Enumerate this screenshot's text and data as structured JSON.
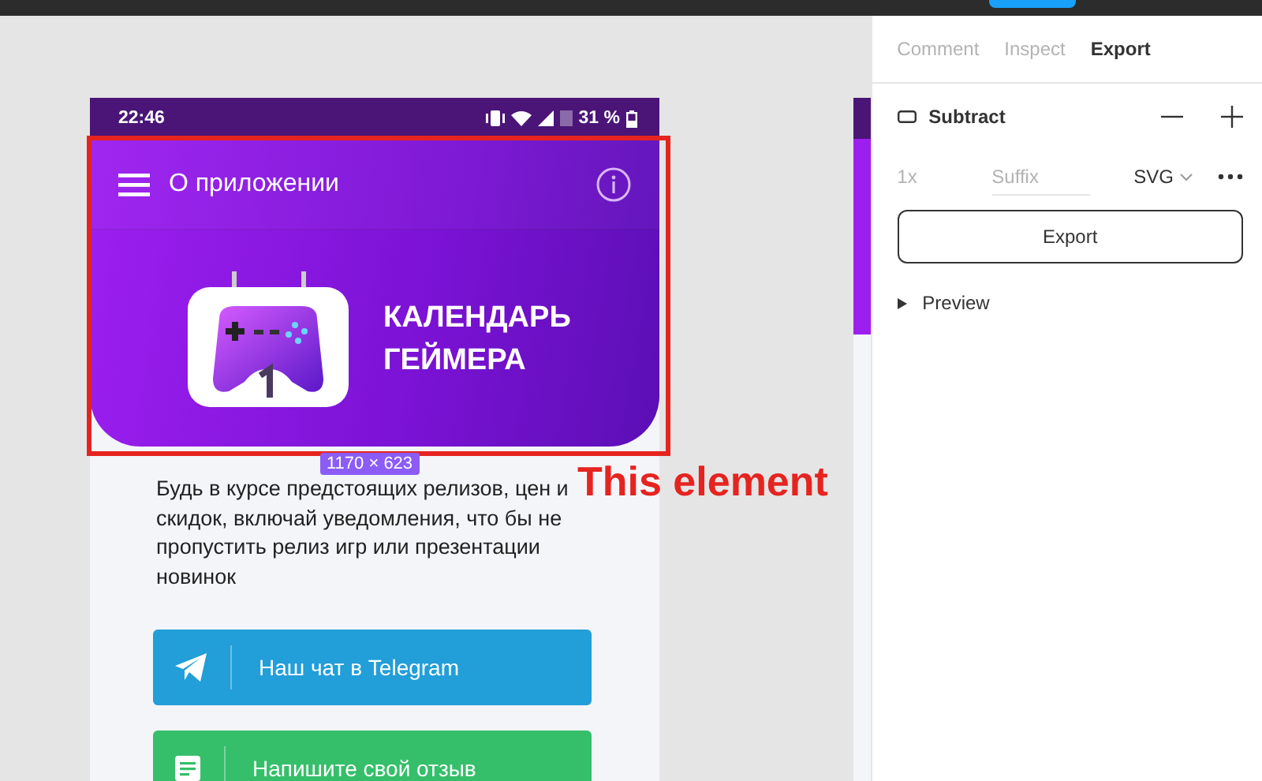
{
  "phone": {
    "status_bar": {
      "time": "22:46",
      "battery": "31 %"
    },
    "app_bar": {
      "title": "О приложении"
    },
    "banner": {
      "title_lines": [
        "КАЛЕНДАРЬ",
        "ГЕЙМЕРА"
      ]
    },
    "description": "Будь в курсе предстоящих релизов, цен и скидок, включай уведомления, что бы не пропустить релиз игр или презентации новинок",
    "buttons": [
      {
        "kind": "telegram",
        "label": "Наш чат в Telegram",
        "color": "#229ed9"
      },
      {
        "kind": "review",
        "label": "Напишите свой отзыв",
        "color": "#35bf6a"
      }
    ]
  },
  "selection": {
    "size": "1170 × 623",
    "annotation": "This element"
  },
  "inspector": {
    "tabs": [
      {
        "label": "Comment",
        "selected": false
      },
      {
        "label": "Inspect",
        "selected": false
      },
      {
        "label": "Export",
        "selected": true
      }
    ],
    "layer": "Subtract",
    "scale": "1x",
    "suffix_placeholder": "Suffix",
    "format": "SVG",
    "export_button": "Export",
    "preview": "Preview"
  }
}
